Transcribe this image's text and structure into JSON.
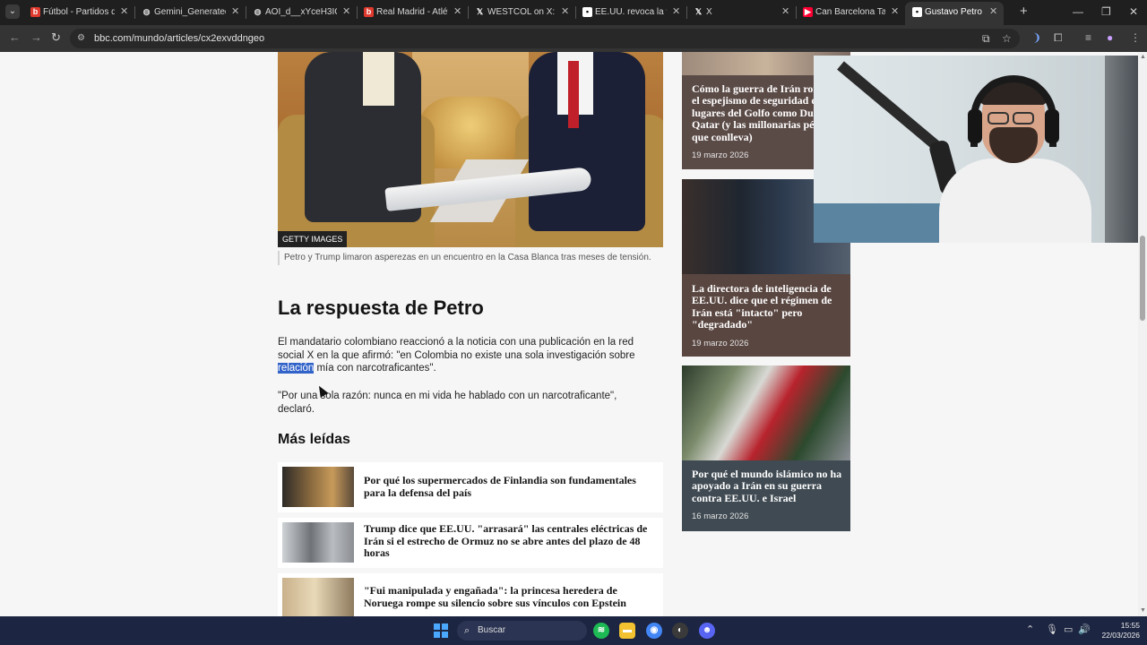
{
  "browser": {
    "tabs": [
      {
        "title": "Fútbol - Partidos de",
        "favicon": "red-b-icon",
        "color": "#e03a2e"
      },
      {
        "title": "Gemini_Generated_Im",
        "favicon": "globe-icon",
        "color": "#9aa0a6"
      },
      {
        "title": "AOI_d__xYceH3IONsq",
        "favicon": "globe-icon",
        "color": "#9aa0a6"
      },
      {
        "title": "Real Madrid - Atlético",
        "favicon": "red-b-icon",
        "color": "#e03a2e"
      },
      {
        "title": "WESTCOL on X: \"😮",
        "favicon": "x-icon",
        "color": "#ffffff"
      },
      {
        "title": "EE.UU. revoca la visa",
        "favicon": "bbc-icon",
        "color": "#ffffff"
      },
      {
        "title": "X",
        "favicon": "x-icon",
        "color": "#ffffff"
      },
      {
        "title": "Can Barcelona Take R",
        "favicon": "youtube-icon",
        "color": "#ff0033"
      },
      {
        "title": "Gustavo Petro es par",
        "favicon": "bbc-icon",
        "color": "#ffffff",
        "active": true
      }
    ],
    "new_tab_label": "+",
    "url": "bbc.com/mundo/articles/cx2exvddngeo",
    "window_controls": {
      "minimize": "—",
      "maximize": "❐",
      "close": "✕"
    }
  },
  "article": {
    "image_credit": "GETTY IMAGES",
    "image_caption": "Petro y Trump limaron asperezas en un encuentro en la Casa Blanca tras meses de tensión.",
    "section_heading": "La respuesta de Petro",
    "paragraph1_line1": "El mandatario colombiano reaccionó a la noticia con una publicación en la red",
    "paragraph1_line2": "social X en la que afirmó: \"en Colombia no existe una sola investigación sobre",
    "paragraph1_highlight": "relación",
    "paragraph1_line3_rest": " mía con narcotraficantes\".",
    "paragraph2": "\"Por una sola razón: nunca en mi vida he hablado con un narcotraficante\", declaró."
  },
  "most_read": {
    "heading": "Más leídas",
    "items": [
      {
        "title": "Por qué los supermercados de Finlandia son fundamentales para la defensa del país"
      },
      {
        "title": "Trump dice que EE.UU. \"arrasará\" las centrales eléctricas de Irán si el estrecho de Ormuz no se abre antes del plazo de 48 horas"
      },
      {
        "title": "\"Fui manipulada y engañada\": la princesa heredera de Noruega rompe su silencio sobre sus vínculos con Epstein"
      }
    ]
  },
  "side_cards": [
    {
      "title": "Cómo la guerra de Irán rompió el espejismo de seguridad de lugares del Golfo como Dubái y Qatar (y las millonarias pérdidas que conlleva)",
      "date": "19 marzo 2026"
    },
    {
      "title": "La directora de inteligencia de EE.UU. dice que el régimen de Irán está \"intacto\" pero \"degradado\"",
      "date": "19 marzo 2026"
    },
    {
      "title": "Por qué el mundo islámico no ha apoyado a Irán en su guerra contra EE.UU. e Israel",
      "date": "16 marzo 2026"
    }
  ],
  "taskbar": {
    "search_placeholder": "Buscar",
    "time": "15:55",
    "date": "22/03/2026"
  }
}
